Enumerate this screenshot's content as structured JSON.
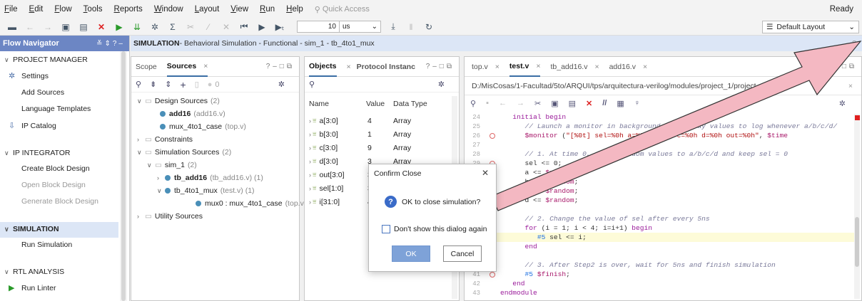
{
  "menu": {
    "items": [
      "File",
      "Edit",
      "Flow",
      "Tools",
      "Reports",
      "Window",
      "Layout",
      "View",
      "Run",
      "Help"
    ],
    "quick_access": "Quick Access",
    "status": "Ready"
  },
  "toolbar": {
    "time_value": "10",
    "time_unit": "us",
    "layout": "Default Layout"
  },
  "flow_nav": {
    "title": "Flow Navigator",
    "sections": [
      {
        "label": "PROJECT MANAGER",
        "items": [
          "Settings",
          "Add Sources",
          "Language Templates",
          "IP Catalog"
        ]
      },
      {
        "label": "IP INTEGRATOR",
        "items": [
          "Create Block Design",
          "Open Block Design",
          "Generate Block Design"
        ]
      },
      {
        "label": "SIMULATION",
        "items": [
          "Run Simulation"
        ]
      },
      {
        "label": "RTL ANALYSIS",
        "items": [
          "Run Linter"
        ]
      }
    ]
  },
  "sim_header": {
    "title": "SIMULATION",
    "detail": " - Behavioral Simulation - Functional - sim_1 - tb_4to1_mux"
  },
  "sources": {
    "tabs": [
      "Scope",
      "Sources"
    ],
    "count_badge": "0",
    "tree": [
      {
        "label": "Design Sources",
        "suffix": "(2)"
      },
      {
        "label": "add16",
        "suffix": "(add16.v)"
      },
      {
        "label": "mux_4to1_case",
        "suffix": "(top.v)"
      },
      {
        "label": "Constraints",
        "suffix": ""
      },
      {
        "label": "Simulation Sources",
        "suffix": "(2)"
      },
      {
        "label": "sim_1",
        "suffix": "(2)"
      },
      {
        "label": "tb_add16",
        "suffix": "(tb_add16.v) (1)"
      },
      {
        "label": "tb_4to1_mux",
        "suffix": "(test.v) (1)"
      },
      {
        "label": "mux0 : mux_4to1_case",
        "suffix": "(top.v)"
      },
      {
        "label": "Utility Sources",
        "suffix": ""
      }
    ]
  },
  "objects": {
    "tabs": [
      "Objects",
      "Protocol Instanc"
    ],
    "columns": [
      "Name",
      "Value",
      "Data Type"
    ],
    "rows": [
      {
        "name": "a[3:0]",
        "value": "4",
        "type": "Array"
      },
      {
        "name": "b[3:0]",
        "value": "1",
        "type": "Array"
      },
      {
        "name": "c[3:0]",
        "value": "9",
        "type": "Array"
      },
      {
        "name": "d[3:0]",
        "value": "3",
        "type": "Array"
      },
      {
        "name": "out[3:0]",
        "value": "3",
        "type": ""
      },
      {
        "name": "sel[1:0]",
        "value": "3",
        "type": ""
      },
      {
        "name": "i[31:0]",
        "value": "4",
        "type": ""
      }
    ]
  },
  "editor": {
    "tabs": [
      "top.v",
      "test.v",
      "tb_add16.v",
      "add16.v"
    ],
    "path": "D:/MisCosas/1-Facultad/5to/ARQUI/tps/arquitectura-verilog/modules/project_1/project_1",
    "lines": [
      {
        "n": "24",
        "bp": false,
        "text": "   initial begin"
      },
      {
        "n": "25",
        "bp": false,
        "text": "      // Launch a monitor in background to display values to log whenever a/b/c/d/"
      },
      {
        "n": "26",
        "bp": true,
        "text": "      $monitor (\"[%0t] sel=%0h a=%0h b=%0h c=%0h d=%0h out=%0h\", $time"
      },
      {
        "n": "27",
        "bp": false,
        "text": ""
      },
      {
        "n": "28",
        "bp": false,
        "text": "      // 1. At time 0, drive random values to a/b/c/d and keep sel = 0"
      },
      {
        "n": "29",
        "bp": true,
        "text": "      sel <= 0;"
      },
      {
        "n": "30",
        "bp": true,
        "text": "      a <= $random;"
      },
      {
        "n": "31",
        "bp": true,
        "text": "      b <= $random;"
      },
      {
        "n": "32",
        "bp": true,
        "text": "      c <= $random;"
      },
      {
        "n": "33",
        "bp": true,
        "text": "      d <= $random;"
      },
      {
        "n": "34",
        "bp": false,
        "text": ""
      },
      {
        "n": "35",
        "bp": false,
        "text": "      // 2. Change the value of sel after every 5ns"
      },
      {
        "n": "36",
        "bp": true,
        "text": "      for (i = 1; i < 4; i=i+1) begin"
      },
      {
        "n": "37",
        "bp": true,
        "text": "         #5 sel <= i;"
      },
      {
        "n": "38",
        "bp": true,
        "text": "      end"
      },
      {
        "n": "39",
        "bp": false,
        "text": ""
      },
      {
        "n": "40",
        "bp": false,
        "text": "      // 3. After Step2 is over, wait for 5ns and finish simulation"
      },
      {
        "n": "41",
        "bp": true,
        "text": "      #5 $finish;"
      },
      {
        "n": "42",
        "bp": false,
        "text": "   end"
      },
      {
        "n": "43",
        "bp": false,
        "text": "endmodule"
      }
    ]
  },
  "dialog": {
    "title": "Confirm Close",
    "message": "OK to close simulation?",
    "checkbox_label": "Don't show this dialog again",
    "ok": "OK",
    "cancel": "Cancel"
  },
  "colors": {
    "accent": "#6c86c4",
    "arrow": "#f4b8c2"
  }
}
